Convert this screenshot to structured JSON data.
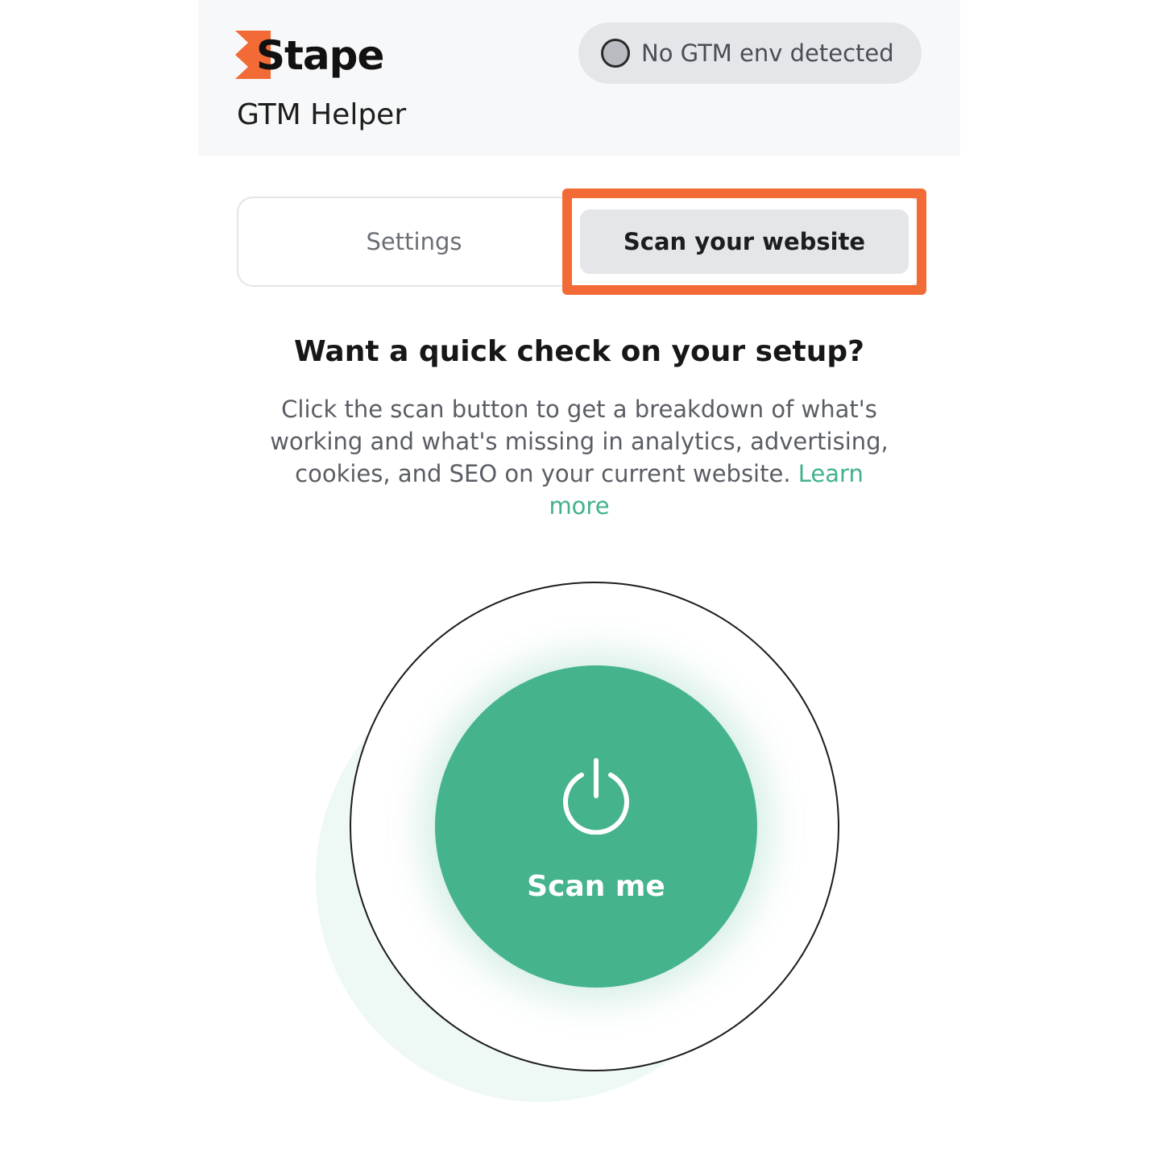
{
  "header": {
    "brand": "Stape",
    "product": "GTM Helper",
    "env_status": "No GTM env detected"
  },
  "tabs": [
    {
      "label": "Settings",
      "active": false
    },
    {
      "label": "Scan your website",
      "active": true
    }
  ],
  "main": {
    "headline": "Want a quick check on your setup?",
    "description": "Click the scan button to get a breakdown of what's working and what's missing in analytics, advertising, cookies, and SEO on your current website.",
    "learn_more": "Learn more"
  },
  "scan": {
    "label": "Scan me",
    "icon": "power-icon"
  },
  "colors": {
    "brand_orange": "#f26a35",
    "accent_green": "#45b38c",
    "link_green": "#43b28b"
  }
}
